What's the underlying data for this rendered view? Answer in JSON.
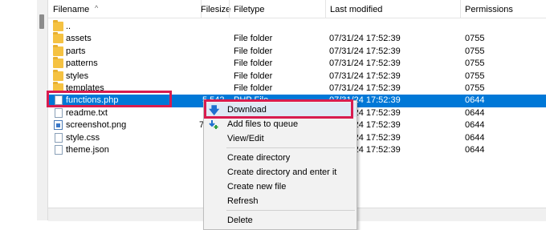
{
  "columns": {
    "filename": "Filename",
    "filesize": "Filesize",
    "filetype": "Filetype",
    "last_modified": "Last modified",
    "permissions": "Permissions"
  },
  "rows": [
    {
      "name": "..",
      "size": "",
      "type": "",
      "modified": "",
      "perm": "",
      "icon": "folder-icon"
    },
    {
      "name": "assets",
      "size": "",
      "type": "File folder",
      "modified": "07/31/24 17:52:39",
      "perm": "0755",
      "icon": "folder-icon"
    },
    {
      "name": "parts",
      "size": "",
      "type": "File folder",
      "modified": "07/31/24 17:52:39",
      "perm": "0755",
      "icon": "folder-icon"
    },
    {
      "name": "patterns",
      "size": "",
      "type": "File folder",
      "modified": "07/31/24 17:52:39",
      "perm": "0755",
      "icon": "folder-icon"
    },
    {
      "name": "styles",
      "size": "",
      "type": "File folder",
      "modified": "07/31/24 17:52:39",
      "perm": "0755",
      "icon": "folder-icon"
    },
    {
      "name": "templates",
      "size": "",
      "type": "File folder",
      "modified": "07/31/24 17:52:39",
      "perm": "0755",
      "icon": "folder-icon"
    },
    {
      "name": "functions.php",
      "size": "5,542",
      "type": "PHP File",
      "modified": "07/31/24 17:52:39",
      "perm": "0644",
      "icon": "document-icon",
      "selected": true
    },
    {
      "name": "readme.txt",
      "size": "",
      "type": "",
      "modified": "07/31/24 17:52:39",
      "perm": "0644",
      "icon": "document-icon"
    },
    {
      "name": "screenshot.png",
      "size": "7",
      "type": "",
      "modified": "07/31/24 17:52:39",
      "perm": "0644",
      "icon": "image-icon"
    },
    {
      "name": "style.css",
      "size": "",
      "type": "",
      "modified": "07/31/24 17:52:39",
      "perm": "0644",
      "icon": "document-icon"
    },
    {
      "name": "theme.json",
      "size": "",
      "type": "",
      "modified": "07/31/24 17:52:39",
      "perm": "0644",
      "icon": "document-icon"
    }
  ],
  "context_menu": {
    "items": [
      {
        "label": "Download",
        "icon": "download-icon"
      },
      {
        "label": "Add files to queue",
        "icon": "add-to-queue-icon"
      },
      {
        "label": "View/Edit"
      },
      {
        "separator": true
      },
      {
        "label": "Create directory"
      },
      {
        "label": "Create directory and enter it"
      },
      {
        "label": "Create new file"
      },
      {
        "label": "Refresh"
      },
      {
        "separator": true
      },
      {
        "label": "Delete"
      }
    ]
  },
  "colors": {
    "selection": "#0078d7",
    "highlight_outline": "#d81c4f",
    "folder": "#f5c242"
  }
}
